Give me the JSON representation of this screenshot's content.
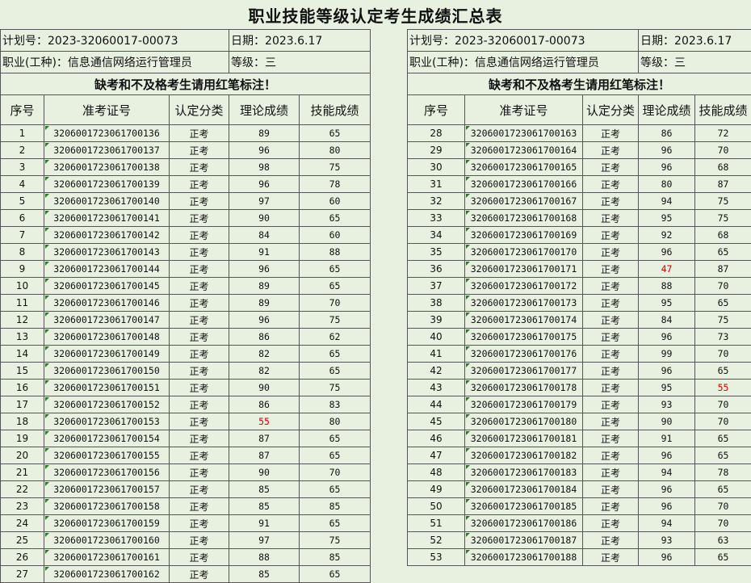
{
  "title": "职业技能等级认定考生成绩汇总表",
  "plan_label": "计划号：2023-32060017-00073",
  "date_label": "日期：2023.6.17",
  "occupation_label": "职业(工种)：信息通信网络运行管理员",
  "level_label": "等级：三",
  "note": "缺考和不及格考生请用红笔标注！",
  "headers": [
    "序号",
    "准考证号",
    "认定分类",
    "理论成绩",
    "技能成绩"
  ],
  "category": "正考",
  "fail_color": "#e00000",
  "left_rows": [
    {
      "no": "1",
      "id": "3206001723061700136",
      "cat": "正考",
      "theory": "89",
      "skill": "65"
    },
    {
      "no": "2",
      "id": "3206001723061700137",
      "cat": "正考",
      "theory": "96",
      "skill": "80"
    },
    {
      "no": "3",
      "id": "3206001723061700138",
      "cat": "正考",
      "theory": "98",
      "skill": "75"
    },
    {
      "no": "4",
      "id": "3206001723061700139",
      "cat": "正考",
      "theory": "96",
      "skill": "78"
    },
    {
      "no": "5",
      "id": "3206001723061700140",
      "cat": "正考",
      "theory": "97",
      "skill": "60"
    },
    {
      "no": "6",
      "id": "3206001723061700141",
      "cat": "正考",
      "theory": "90",
      "skill": "65"
    },
    {
      "no": "7",
      "id": "3206001723061700142",
      "cat": "正考",
      "theory": "84",
      "skill": "60"
    },
    {
      "no": "8",
      "id": "3206001723061700143",
      "cat": "正考",
      "theory": "91",
      "skill": "88"
    },
    {
      "no": "9",
      "id": "3206001723061700144",
      "cat": "正考",
      "theory": "96",
      "skill": "65"
    },
    {
      "no": "10",
      "id": "3206001723061700145",
      "cat": "正考",
      "theory": "89",
      "skill": "65"
    },
    {
      "no": "11",
      "id": "3206001723061700146",
      "cat": "正考",
      "theory": "89",
      "skill": "70"
    },
    {
      "no": "12",
      "id": "3206001723061700147",
      "cat": "正考",
      "theory": "96",
      "skill": "75"
    },
    {
      "no": "13",
      "id": "3206001723061700148",
      "cat": "正考",
      "theory": "86",
      "skill": "62"
    },
    {
      "no": "14",
      "id": "3206001723061700149",
      "cat": "正考",
      "theory": "82",
      "skill": "65"
    },
    {
      "no": "15",
      "id": "3206001723061700150",
      "cat": "正考",
      "theory": "82",
      "skill": "65"
    },
    {
      "no": "16",
      "id": "3206001723061700151",
      "cat": "正考",
      "theory": "90",
      "skill": "75"
    },
    {
      "no": "17",
      "id": "3206001723061700152",
      "cat": "正考",
      "theory": "86",
      "skill": "83"
    },
    {
      "no": "18",
      "id": "3206001723061700153",
      "cat": "正考",
      "theory": "55",
      "skill": "80",
      "theory_fail": true
    },
    {
      "no": "19",
      "id": "3206001723061700154",
      "cat": "正考",
      "theory": "87",
      "skill": "65"
    },
    {
      "no": "20",
      "id": "3206001723061700155",
      "cat": "正考",
      "theory": "87",
      "skill": "65"
    },
    {
      "no": "21",
      "id": "3206001723061700156",
      "cat": "正考",
      "theory": "90",
      "skill": "70"
    },
    {
      "no": "22",
      "id": "3206001723061700157",
      "cat": "正考",
      "theory": "85",
      "skill": "65"
    },
    {
      "no": "23",
      "id": "3206001723061700158",
      "cat": "正考",
      "theory": "85",
      "skill": "85"
    },
    {
      "no": "24",
      "id": "3206001723061700159",
      "cat": "正考",
      "theory": "91",
      "skill": "65"
    },
    {
      "no": "25",
      "id": "3206001723061700160",
      "cat": "正考",
      "theory": "97",
      "skill": "75"
    },
    {
      "no": "26",
      "id": "3206001723061700161",
      "cat": "正考",
      "theory": "88",
      "skill": "85"
    },
    {
      "no": "27",
      "id": "3206001723061700162",
      "cat": "正考",
      "theory": "85",
      "skill": "65"
    }
  ],
  "right_rows": [
    {
      "no": "28",
      "id": "3206001723061700163",
      "cat": "正考",
      "theory": "86",
      "skill": "72"
    },
    {
      "no": "29",
      "id": "3206001723061700164",
      "cat": "正考",
      "theory": "96",
      "skill": "70"
    },
    {
      "no": "30",
      "id": "3206001723061700165",
      "cat": "正考",
      "theory": "96",
      "skill": "68"
    },
    {
      "no": "31",
      "id": "3206001723061700166",
      "cat": "正考",
      "theory": "80",
      "skill": "87"
    },
    {
      "no": "32",
      "id": "3206001723061700167",
      "cat": "正考",
      "theory": "94",
      "skill": "75"
    },
    {
      "no": "33",
      "id": "3206001723061700168",
      "cat": "正考",
      "theory": "95",
      "skill": "75"
    },
    {
      "no": "34",
      "id": "3206001723061700169",
      "cat": "正考",
      "theory": "92",
      "skill": "68"
    },
    {
      "no": "35",
      "id": "3206001723061700170",
      "cat": "正考",
      "theory": "96",
      "skill": "65"
    },
    {
      "no": "36",
      "id": "3206001723061700171",
      "cat": "正考",
      "theory": "47",
      "skill": "87",
      "theory_fail": true
    },
    {
      "no": "37",
      "id": "3206001723061700172",
      "cat": "正考",
      "theory": "88",
      "skill": "70"
    },
    {
      "no": "38",
      "id": "3206001723061700173",
      "cat": "正考",
      "theory": "95",
      "skill": "65"
    },
    {
      "no": "39",
      "id": "3206001723061700174",
      "cat": "正考",
      "theory": "84",
      "skill": "75"
    },
    {
      "no": "40",
      "id": "3206001723061700175",
      "cat": "正考",
      "theory": "96",
      "skill": "73"
    },
    {
      "no": "41",
      "id": "3206001723061700176",
      "cat": "正考",
      "theory": "99",
      "skill": "70"
    },
    {
      "no": "42",
      "id": "3206001723061700177",
      "cat": "正考",
      "theory": "96",
      "skill": "65"
    },
    {
      "no": "43",
      "id": "3206001723061700178",
      "cat": "正考",
      "theory": "95",
      "skill": "55",
      "skill_fail": true
    },
    {
      "no": "44",
      "id": "3206001723061700179",
      "cat": "正考",
      "theory": "93",
      "skill": "70"
    },
    {
      "no": "45",
      "id": "3206001723061700180",
      "cat": "正考",
      "theory": "90",
      "skill": "70"
    },
    {
      "no": "46",
      "id": "3206001723061700181",
      "cat": "正考",
      "theory": "91",
      "skill": "65"
    },
    {
      "no": "47",
      "id": "3206001723061700182",
      "cat": "正考",
      "theory": "96",
      "skill": "65"
    },
    {
      "no": "48",
      "id": "3206001723061700183",
      "cat": "正考",
      "theory": "94",
      "skill": "78"
    },
    {
      "no": "49",
      "id": "3206001723061700184",
      "cat": "正考",
      "theory": "96",
      "skill": "65"
    },
    {
      "no": "50",
      "id": "3206001723061700185",
      "cat": "正考",
      "theory": "96",
      "skill": "70"
    },
    {
      "no": "51",
      "id": "3206001723061700186",
      "cat": "正考",
      "theory": "94",
      "skill": "70"
    },
    {
      "no": "52",
      "id": "3206001723061700187",
      "cat": "正考",
      "theory": "93",
      "skill": "63"
    },
    {
      "no": "53",
      "id": "3206001723061700188",
      "cat": "正考",
      "theory": "96",
      "skill": "65"
    }
  ]
}
